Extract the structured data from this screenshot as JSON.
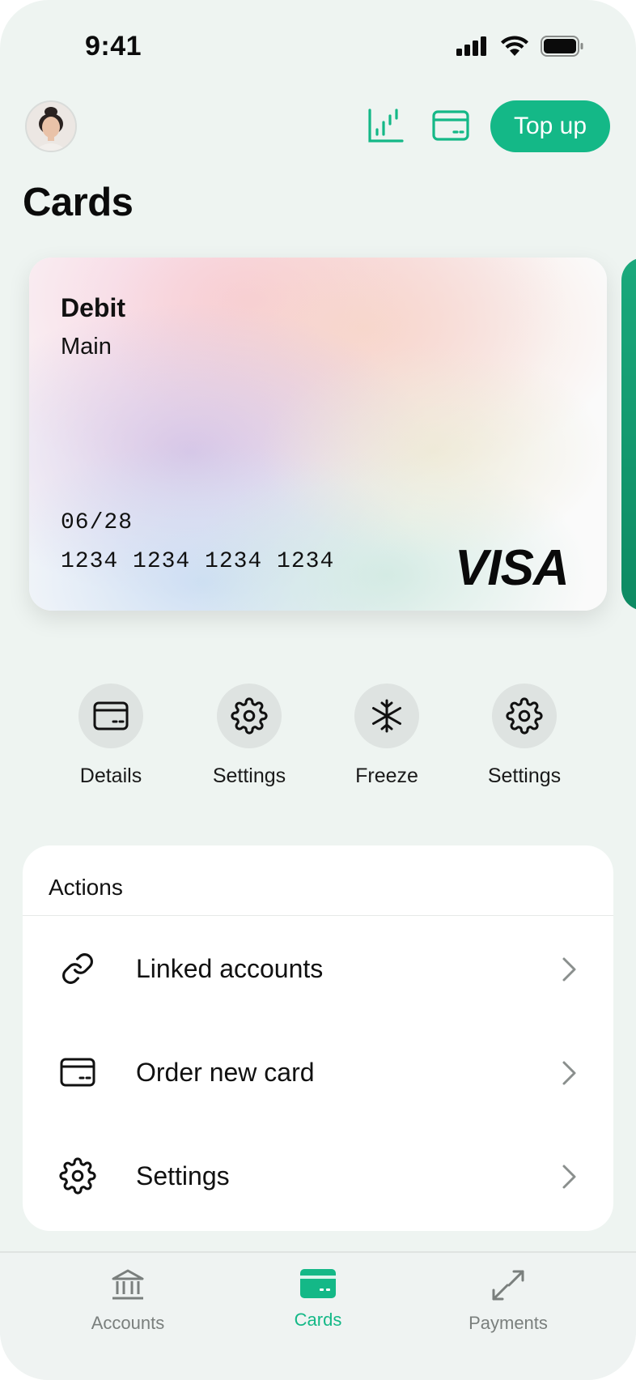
{
  "status_bar": {
    "time": "9:41"
  },
  "header": {
    "topup_label": "Top up",
    "title": "Cards"
  },
  "card": {
    "type": "Debit",
    "name": "Main",
    "expiry": "06/28",
    "number": "1234 1234 1234 1234",
    "network": "VISA"
  },
  "quick_actions": [
    {
      "label": "Details",
      "icon": "card-icon"
    },
    {
      "label": "Settings",
      "icon": "gear-icon"
    },
    {
      "label": "Freeze",
      "icon": "snowflake-icon"
    },
    {
      "label": "Settings",
      "icon": "gear-icon"
    }
  ],
  "actions_panel": {
    "title": "Actions",
    "items": [
      {
        "label": "Linked accounts",
        "icon": "link-icon"
      },
      {
        "label": "Order new card",
        "icon": "card-icon"
      },
      {
        "label": "Settings",
        "icon": "gear-icon"
      }
    ]
  },
  "tabbar": {
    "items": [
      {
        "label": "Accounts",
        "icon": "bank-icon",
        "active": false
      },
      {
        "label": "Cards",
        "icon": "card-icon",
        "active": true
      },
      {
        "label": "Payments",
        "icon": "transfer-icon",
        "active": false
      }
    ]
  },
  "colors": {
    "accent": "#14b887",
    "background": "#eef4f1",
    "text": "#111111",
    "muted": "#7a7f7d"
  }
}
